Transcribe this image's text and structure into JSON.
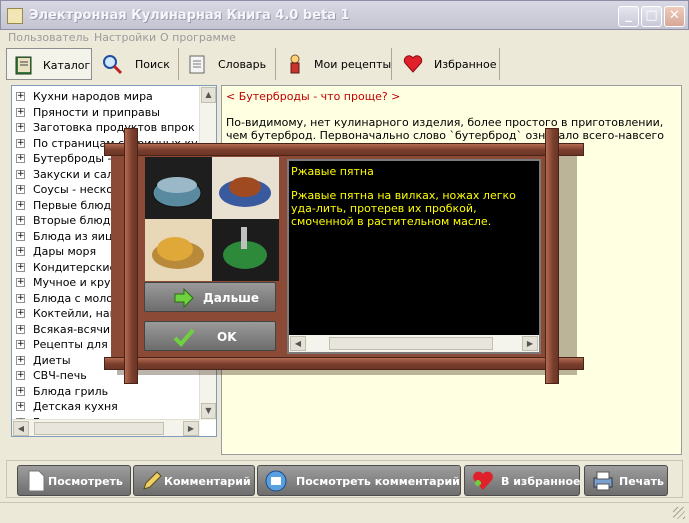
{
  "window": {
    "title": "Электронная Кулинарная Книга 4.0 beta 1",
    "controls": [
      "minimize",
      "maximize",
      "close"
    ]
  },
  "menu": {
    "items": [
      "Пользователь",
      "Настройки",
      "О программе"
    ]
  },
  "tabs": [
    {
      "label": "Каталог",
      "icon": "book-icon",
      "active": true
    },
    {
      "label": "Поиск",
      "icon": "magnifier-icon",
      "active": false
    },
    {
      "label": "Словарь",
      "icon": "notepad-icon",
      "active": false
    },
    {
      "label": "Мои рецепты",
      "icon": "chef-icon",
      "active": false
    },
    {
      "label": "Избранное",
      "icon": "heart-icon",
      "active": false
    }
  ],
  "catalog": {
    "items": [
      "Кухни народов мира",
      "Пряности и приправы",
      "Заготовка продуктов впрок",
      "По страницам старинных кулина",
      "Бутерброды - что проще?",
      "Закуски и салаты",
      "Соусы - несколько простых",
      "Первые блюда",
      "Вторые блюда",
      "Блюда из яиц",
      "Дары моря",
      "Кондитерские изделия",
      "Мучное и крупы",
      "Блюда с молочными продуктами",
      "Коктейли, напитки",
      "Всякая-всячина",
      "Рецепты для специальных",
      "Диеты",
      "СВЧ-печь",
      "Блюда гриль",
      "Детская кухня",
      "Гарниры"
    ]
  },
  "article": {
    "heading": "< Бутерброды - что проще? >",
    "text": "По-видимому, нет кулинарного изделия, более простого в приготовлении, чем бутерброд. Первоначально слово `бутерброд` означало всего-навсего `Хлеб с маслом`. Сего"
  },
  "popup": {
    "next_label": "Дальше",
    "ok_label": "OK",
    "tip_title": "Ржавые пятна",
    "tip_text": "Ржавые пятна на вилках, ножах легко уда-лить, протерев их пробкой, смоченной в растительном масле."
  },
  "bottom_buttons": [
    {
      "label": "Посмотреть",
      "icon": "document-icon"
    },
    {
      "label": "Комментарий",
      "icon": "pen-icon"
    },
    {
      "label": "Посмотреть комментарий",
      "icon": "view-comment-icon"
    },
    {
      "label": "В избранное",
      "icon": "add-favorite-icon"
    },
    {
      "label": "Печать",
      "icon": "printer-icon"
    }
  ],
  "colors": {
    "window_bg": "#ece9d8",
    "article_bg": "#ffffe1",
    "heading_red": "#c00000",
    "tip_bg": "#000000",
    "tip_text": "#ffff00",
    "frame_wood": "#7a3e2c"
  }
}
